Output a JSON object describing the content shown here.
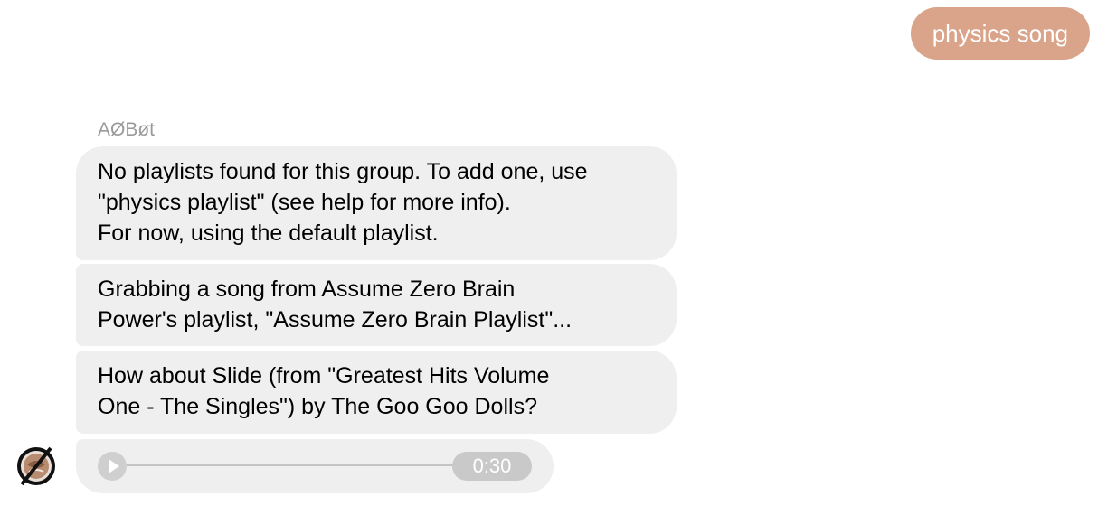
{
  "outgoing_message": {
    "text": "physics song",
    "color": "#d9a48a"
  },
  "incoming": {
    "sender_name": "AØBøt",
    "bubble_color": "#efefef",
    "messages": [
      {
        "lines": [
          "No playlists found for this group. To add one, use",
          "\"physics playlist\" (see help for more info).",
          "For now, using the default playlist."
        ]
      },
      {
        "lines": [
          "Grabbing a song from Assume Zero Brain",
          "Power's playlist, \"Assume Zero Brain Playlist\"..."
        ]
      },
      {
        "lines": [
          "How about Slide (from \"Greatest Hits Volume",
          "One - The Singles\") by The Goo Goo Dolls?"
        ]
      }
    ],
    "audio": {
      "play_icon": "play-icon",
      "progress": 0,
      "duration": "0:30"
    },
    "avatar_icon": "bot-avatar-icon"
  }
}
